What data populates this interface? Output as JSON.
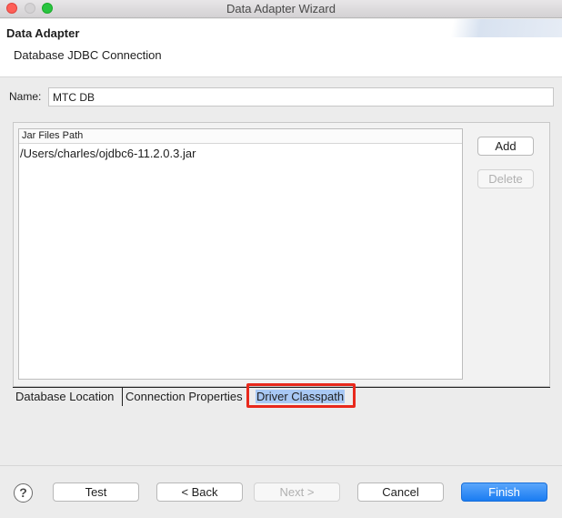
{
  "window": {
    "title": "Data Adapter Wizard"
  },
  "header": {
    "title": "Data Adapter",
    "subtitle": "Database JDBC Connection"
  },
  "name_field": {
    "label": "Name:",
    "value": "MTC DB"
  },
  "jar_table": {
    "column_header": "Jar Files Path",
    "rows": [
      "/Users/charles/ojdbc6-11.2.0.3.jar"
    ]
  },
  "side_buttons": {
    "add": "Add",
    "delete": "Delete"
  },
  "tabs": [
    {
      "label": "Database Location"
    },
    {
      "label": "Connection Properties"
    },
    {
      "label": "Driver Classpath",
      "selected": true
    }
  ],
  "footer": {
    "help": "?",
    "test": "Test",
    "back": "< Back",
    "next": "Next >",
    "cancel": "Cancel",
    "finish": "Finish"
  },
  "colors": {
    "accent": "#1a7cf2",
    "highlight_box": "#e8291c",
    "selected_tab_bg": "#a8c8f4"
  }
}
